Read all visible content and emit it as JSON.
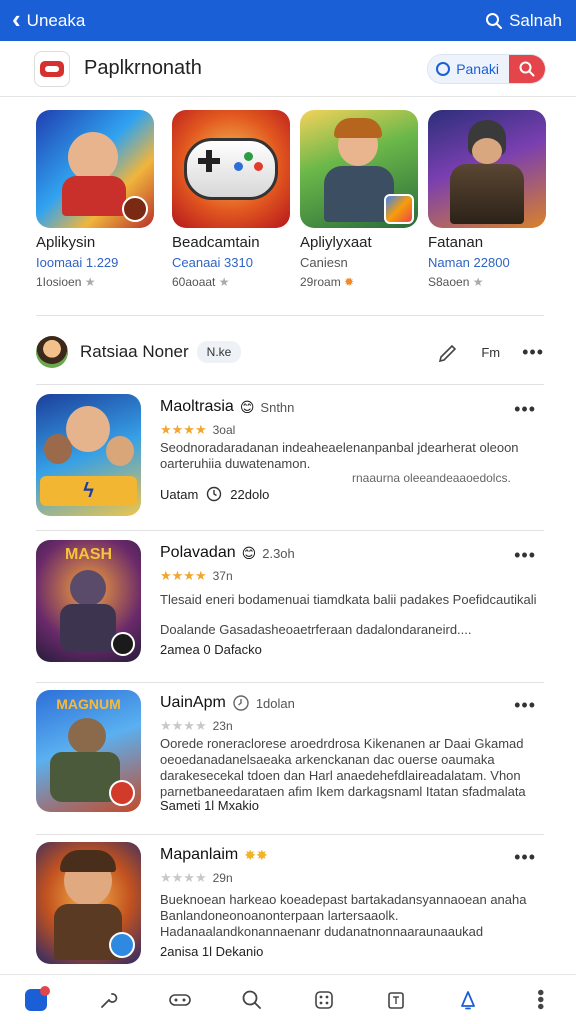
{
  "topbar": {
    "back_label": "Uneaka",
    "search_label": "Salnah"
  },
  "header": {
    "title": "Paplkrnonath",
    "search_button_label": "Panaki"
  },
  "featured": [
    {
      "name": "Aplikysin",
      "subtitle": "Ioomaai 1.229",
      "meta": "1Iosioen"
    },
    {
      "name": "Beadcamtain",
      "subtitle": "Ceanaai 3310",
      "meta": "60aoaat"
    },
    {
      "name": "Apliylyxaat",
      "subtitle": "Caniesn",
      "meta": "29roam"
    },
    {
      "name": "Fatanan",
      "subtitle": "Naman 22800",
      "meta": "S8aoen"
    }
  ],
  "section": {
    "title": "Ratsiaa Noner",
    "chip": "N.ke",
    "action_label": "Fm"
  },
  "list": [
    {
      "title": "Maoltrasia",
      "time": "Snthn",
      "rating_count": "3oal",
      "description": "Seodnoradaradanan indeaheaelenanpanbal jdearherat oleoon oarteruhiia duwatenamon.",
      "description2": "rnaaurna oleeandeaaoedolcs.",
      "footer": "Uatam",
      "footer_time": "22dolo"
    },
    {
      "title": "Polavadan",
      "time": "2.3oh",
      "rating_count": "37n",
      "description": "Tlesaid eneri bodamenuai tiamdkata balii padakes Poefidcautikali",
      "description2": "Doalande Gasadasheoaetrferaan dadalondaraneird....",
      "footer": "2amea 0 Dafacko",
      "footer_time": ""
    },
    {
      "title": "UainApm",
      "time": "1dolan",
      "rating_count": "23n",
      "description": "Oorede roneraclorese aroedrdrosa Kikenanen ar Daai Gkamad oeoedanadanelsaeaka arkenckanan dac ouerse oaumaka darakesecekal tdoen dan Harl anaedehefdlaireadalatam. Vhon parnetbaneedarataen afim Ikem darkagsnaml Itatan sfadmalata",
      "description2": "",
      "footer": "Sameti 1l Mxakio",
      "footer_time": ""
    },
    {
      "title": "Mapanlaim",
      "time": "",
      "rating_count": "29n",
      "description": "Bueknoean harkeao koeadepast bartakadansyannaoean anaha Banlandoneonoanonterpaan lartersaaolk. Hadanaalandkonannaenanr dudanatnonnaaraunaaukad",
      "description2": "",
      "footer": "2anisa 1l Dekanio",
      "footer_time": ""
    }
  ],
  "colors": {
    "primary": "#1a5fd6",
    "accent": "#e3454a",
    "star": "#f4a62a"
  }
}
